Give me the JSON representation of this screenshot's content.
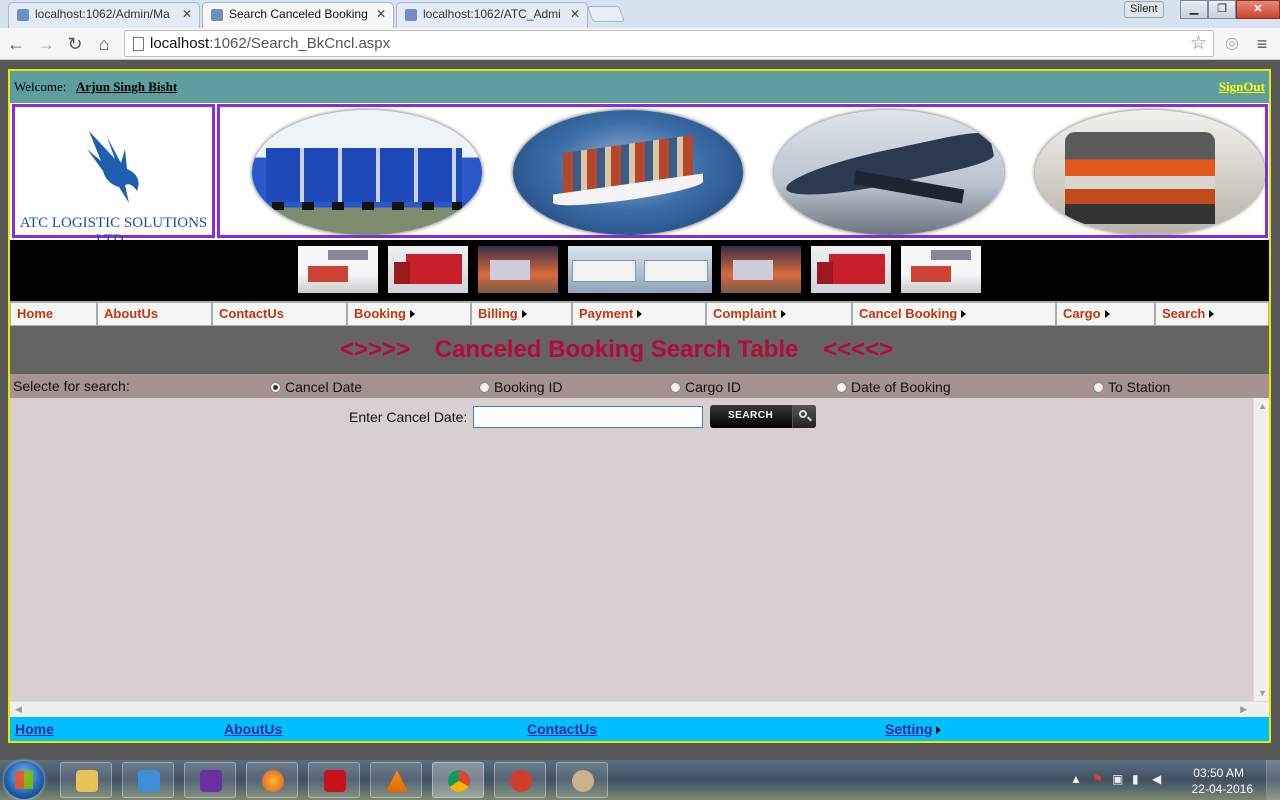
{
  "browser": {
    "tabs": [
      {
        "title": "localhost:1062/Admin/Ma",
        "active": false
      },
      {
        "title": "Search Canceled Booking",
        "active": true
      },
      {
        "title": "localhost:1062/ATC_Admi",
        "active": false
      }
    ],
    "profile_label": "Silent",
    "url_host": "localhost",
    "url_rest": ":1062/Search_BkCncl.aspx"
  },
  "header": {
    "welcome_label": "Welcome:",
    "user_name": "Arjun Singh Bisht",
    "signout_label": "SignOut"
  },
  "logo": {
    "company_name": "ATC LOGISTIC SOLUTIONS LTD.,"
  },
  "menu": {
    "items": [
      {
        "label": "Home",
        "has_submenu": false
      },
      {
        "label": "AboutUs",
        "has_submenu": false
      },
      {
        "label": "ContactUs",
        "has_submenu": false
      },
      {
        "label": "Booking",
        "has_submenu": true
      },
      {
        "label": "Billing",
        "has_submenu": true
      },
      {
        "label": "Payment",
        "has_submenu": true
      },
      {
        "label": "Complaint",
        "has_submenu": true
      },
      {
        "label": "Cancel Booking",
        "has_submenu": true
      },
      {
        "label": "Cargo",
        "has_submenu": true
      },
      {
        "label": "Search",
        "has_submenu": true
      }
    ]
  },
  "title_band": {
    "left_deco": "<>>>>",
    "title": "Canceled Booking Search Table",
    "right_deco": "<<<<>"
  },
  "search_options": {
    "label": "Selecte for search:",
    "options": [
      {
        "label": "Cancel Date",
        "selected": true
      },
      {
        "label": "Booking ID",
        "selected": false
      },
      {
        "label": "Cargo ID",
        "selected": false
      },
      {
        "label": "Date of Booking",
        "selected": false
      },
      {
        "label": "To Station",
        "selected": false
      }
    ]
  },
  "search_form": {
    "field_label": "Enter Cancel Date:",
    "field_value": "",
    "button_label": "SEARCH"
  },
  "footer": {
    "links": [
      {
        "label": "Home"
      },
      {
        "label": "AboutUs"
      },
      {
        "label": "ContactUs"
      },
      {
        "label": "Setting",
        "has_submenu": true
      }
    ]
  },
  "taskbar": {
    "time": "03:50 AM",
    "date": "22-04-2016"
  },
  "colors": {
    "menu_text": "#c0390b",
    "title_text": "#b40a3c",
    "welcome_bar": "#5f9ea0",
    "footer_bar": "#00bfff",
    "frame_border": "#e8e800",
    "banner_border": "#8a2be2"
  }
}
